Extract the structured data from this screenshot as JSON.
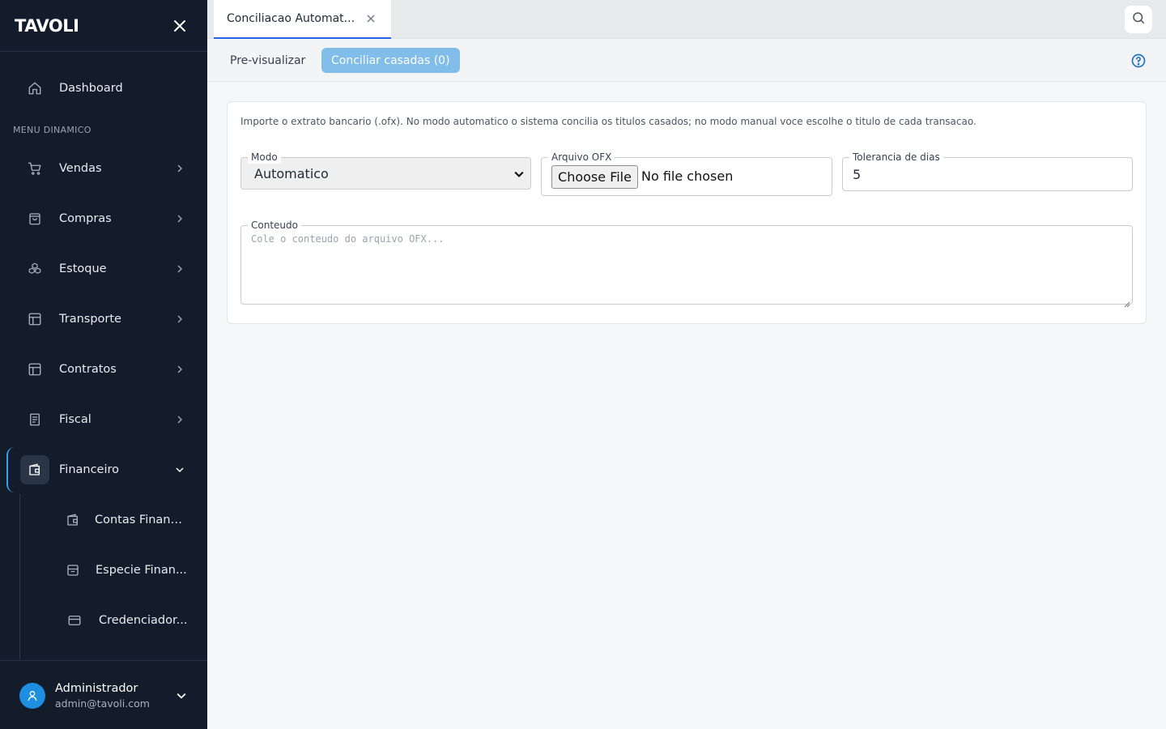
{
  "app": {
    "logo": "TAVOLI"
  },
  "sidebar": {
    "dashboard_label": "Dashboard",
    "section_label": "MENU DINAMICO",
    "items": [
      {
        "label": "Vendas",
        "icon": "cart-icon"
      },
      {
        "label": "Compras",
        "icon": "shopping-bag-icon"
      },
      {
        "label": "Estoque",
        "icon": "boxes-icon"
      },
      {
        "label": "Transporte",
        "icon": "layout-icon"
      },
      {
        "label": "Contratos",
        "icon": "layout-icon"
      },
      {
        "label": "Fiscal",
        "icon": "receipt-icon"
      },
      {
        "label": "Financeiro",
        "icon": "wallet-icon",
        "expanded": true
      }
    ],
    "subitems": [
      {
        "label": "Contas Financ...",
        "icon": "wallet-icon"
      },
      {
        "label": "Especie Finan...",
        "icon": "archive-icon"
      },
      {
        "label": "Credenciador...",
        "icon": "credit-card-icon"
      }
    ]
  },
  "user": {
    "name": "Administrador",
    "email": "admin@tavoli.com"
  },
  "tabs": [
    {
      "label": "Conciliacao Automat...",
      "active": true
    }
  ],
  "toolbar": {
    "preview_label": "Pre-visualizar",
    "conciliar_label": "Conciliar casadas (0)"
  },
  "form": {
    "intro": "Importe o extrato bancario (.ofx). No modo automatico o sistema concilia os titulos casados; no modo manual voce escolhe o titulo de cada transacao.",
    "modo": {
      "label": "Modo",
      "value": "Automatico"
    },
    "arquivo": {
      "label": "Arquivo OFX",
      "button": "Choose File",
      "status": "No file chosen"
    },
    "tolerancia": {
      "label": "Tolerancia de dias",
      "value": "5"
    },
    "conteudo": {
      "label": "Conteudo",
      "placeholder": "Cole o conteudo do arquivo OFX..."
    }
  },
  "colors": {
    "sidebar_bg": "#121c2b",
    "accent": "#2563eb",
    "button_disabled": "#80bde8",
    "avatar": "#1e8fe0"
  }
}
